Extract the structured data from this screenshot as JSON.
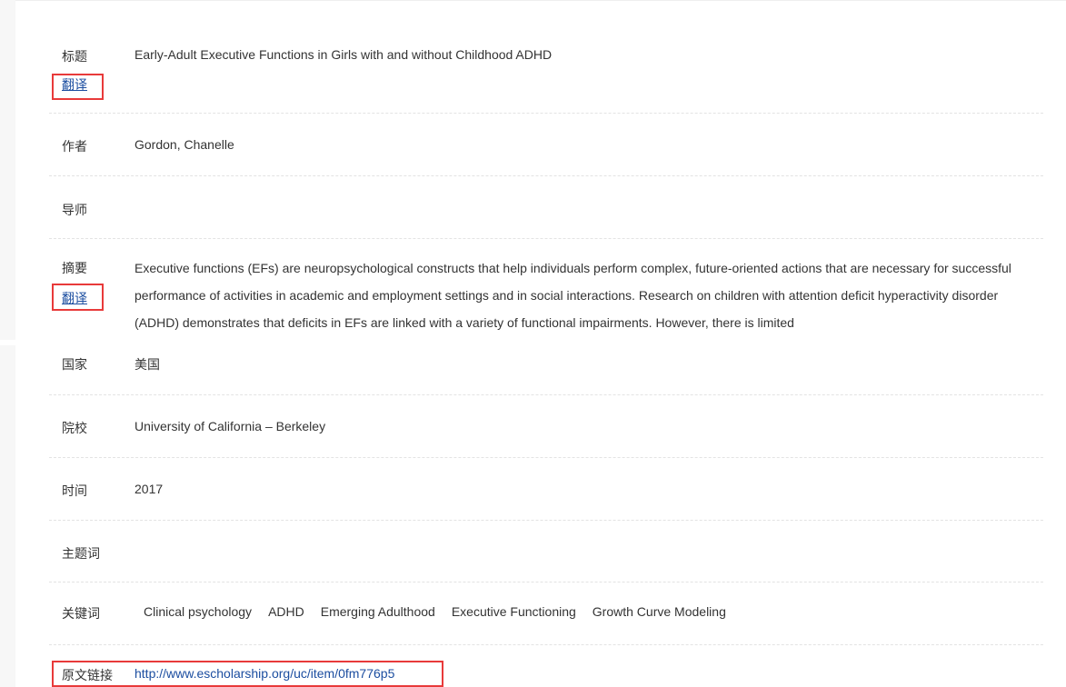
{
  "fields": {
    "title": {
      "label": "标题",
      "translate": "翻译",
      "value": "Early-Adult Executive Functions in Girls with and without Childhood ADHD"
    },
    "author": {
      "label": "作者",
      "value": "Gordon, Chanelle"
    },
    "advisor": {
      "label": "导师",
      "value": ""
    },
    "abstract": {
      "label": "摘要",
      "translate": "翻译",
      "value": "Executive functions (EFs) are neuropsychological constructs that help individuals perform complex, future-oriented actions that are necessary for successful performance of activities in academic and employment settings and in social interactions. Research on children with attention deficit hyperactivity disorder (ADHD) demonstrates that deficits in EFs are linked with a variety of functional impairments. However, there is limited"
    },
    "country": {
      "label": "国家",
      "value": "美国"
    },
    "school": {
      "label": "院校",
      "value": "University of California – Berkeley"
    },
    "date": {
      "label": "时间",
      "value": "2017"
    },
    "subject": {
      "label": "主题词",
      "value": ""
    },
    "keywords": {
      "label": "关键词",
      "items": [
        "Clinical psychology",
        "ADHD",
        "Emerging Adulthood",
        "Executive Functioning",
        "Growth Curve Modeling"
      ]
    },
    "source": {
      "label": "原文链接",
      "url": "http://www.escholarship.org/uc/item/0fm776p5"
    }
  },
  "colors": {
    "link": "#1c4ea0",
    "highlight_box": "#e83a3a",
    "divider": "#e3e3e3"
  }
}
